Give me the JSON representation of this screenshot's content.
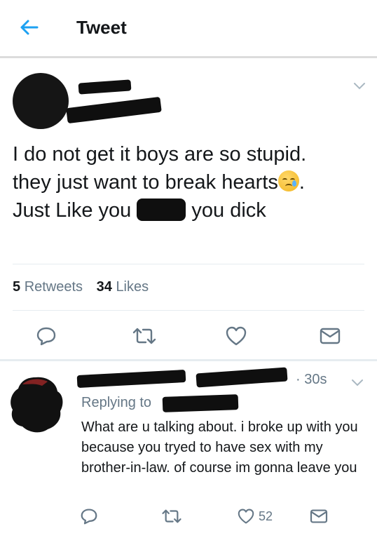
{
  "header": {
    "title": "Tweet",
    "back_icon": "back-arrow-icon",
    "accent_color": "#1da1f2"
  },
  "main_tweet": {
    "text_line1": "I do not get it boys are so stupid.",
    "text_line2": "they just want to break hearts",
    "text_line2_end": ".",
    "emoji": "crying-face-emoji",
    "text_line3_start": "Just Like you ",
    "text_line3_end": " you dick",
    "stats": {
      "retweets_count": "5",
      "retweets_label": "Retweets",
      "likes_count": "34",
      "likes_label": "Likes"
    },
    "actions": [
      "reply-icon",
      "retweet-icon",
      "like-icon",
      "message-icon"
    ]
  },
  "reply_tweet": {
    "time": "· 30s",
    "replying_to_label": "Replying to",
    "text": "What are u talking about. i broke up with you because you tryed to have sex with my brother-in-law. of course im gonna leave you",
    "like_count": "52",
    "actions": [
      "reply-icon",
      "retweet-icon",
      "like-icon",
      "message-icon"
    ]
  }
}
